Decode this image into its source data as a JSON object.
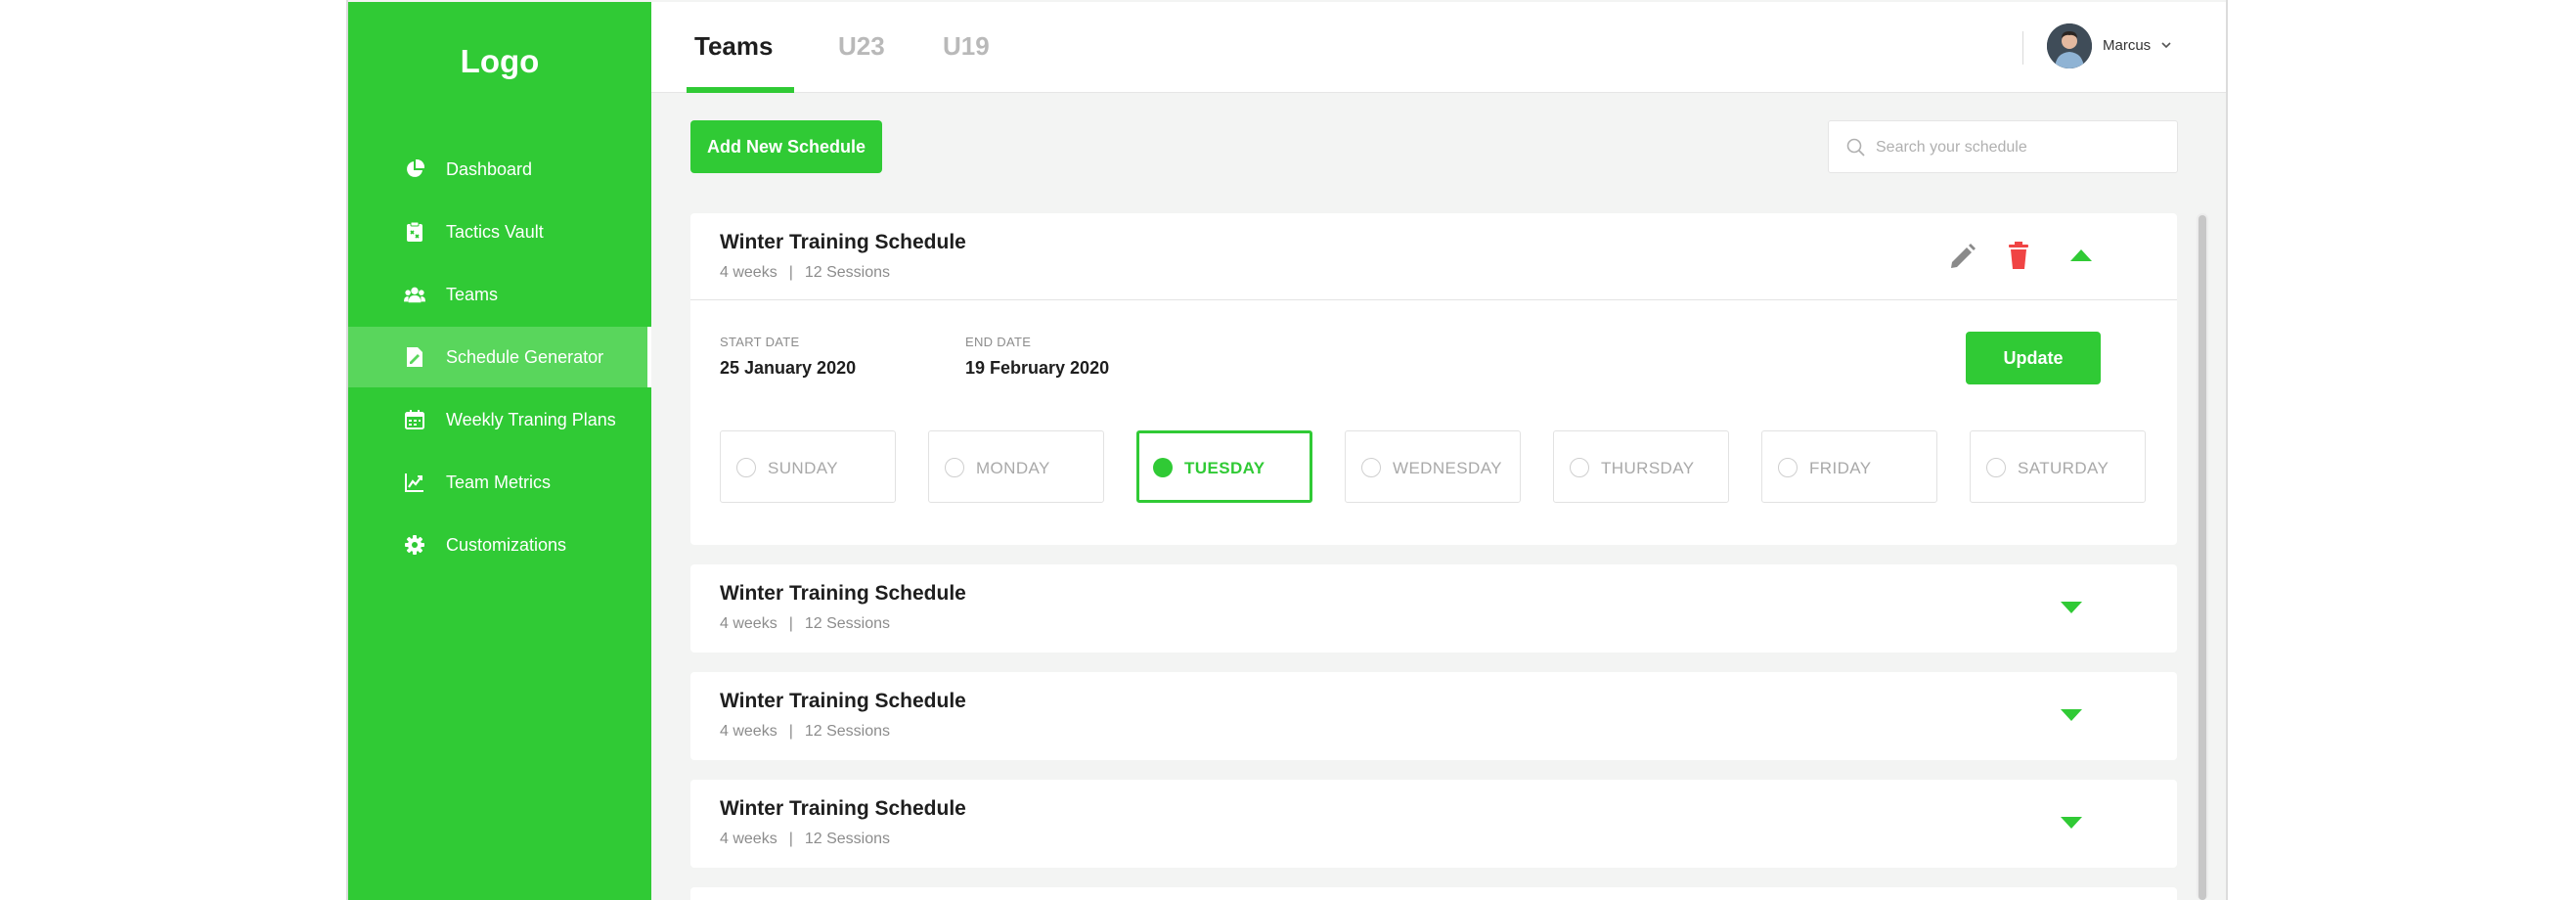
{
  "sidebar": {
    "logo": "Logo",
    "items": [
      {
        "label": "Dashboard",
        "icon": "pie-chart-icon"
      },
      {
        "label": "Tactics Vault",
        "icon": "clipboard-icon"
      },
      {
        "label": "Teams",
        "icon": "users-icon"
      },
      {
        "label": "Schedule Generator",
        "icon": "document-edit-icon",
        "active": true
      },
      {
        "label": "Weekly Traning Plans",
        "icon": "calendar-icon"
      },
      {
        "label": "Team Metrics",
        "icon": "line-chart-icon"
      },
      {
        "label": "Customizations",
        "icon": "gear-icon"
      }
    ]
  },
  "header": {
    "tabs": [
      {
        "label": "Teams",
        "active": true
      },
      {
        "label": "U23"
      },
      {
        "label": "U19"
      }
    ],
    "user": {
      "name": "Marcus"
    }
  },
  "toolbar": {
    "add_label": "Add New Schedule",
    "search_placeholder": "Search your schedule"
  },
  "schedules": [
    {
      "title": "Winter Training Schedule",
      "weeks": "4 weeks",
      "separator": "|",
      "sessions": "12 Sessions",
      "expanded": true,
      "start_label": "START DATE",
      "start_value": "25 January 2020",
      "end_label": "END DATE",
      "end_value": "19 February 2020",
      "update_label": "Update",
      "days": [
        "SUNDAY",
        "MONDAY",
        "TUESDAY",
        "WEDNESDAY",
        "THURSDAY",
        "FRIDAY",
        "SATURDAY"
      ],
      "selected_day": "TUESDAY"
    },
    {
      "title": "Winter Training Schedule",
      "weeks": "4 weeks",
      "separator": "|",
      "sessions": "12 Sessions"
    },
    {
      "title": "Winter Training Schedule",
      "weeks": "4 weeks",
      "separator": "|",
      "sessions": "12 Sessions"
    },
    {
      "title": "Winter Training Schedule",
      "weeks": "4 weeks",
      "separator": "|",
      "sessions": "12 Sessions"
    }
  ],
  "colors": {
    "accent": "#30ca35",
    "sidebar_active": "#59d65c",
    "delete": "#f04444",
    "edit": "#8a8a8a"
  }
}
